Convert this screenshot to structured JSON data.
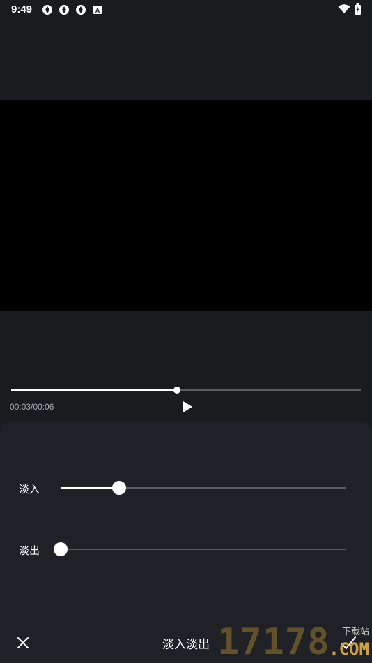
{
  "status_bar": {
    "time": "9:49",
    "notification_icons": [
      "aperture-icon",
      "aperture-icon",
      "aperture-icon",
      "a-badge-icon"
    ],
    "right_icons": [
      "wifi-icon",
      "battery-icon"
    ]
  },
  "player": {
    "progress_fraction": 0.475,
    "time_display": "00:03/00:06",
    "play_icon": "play-icon"
  },
  "panel": {
    "fade_in": {
      "label": "淡入",
      "value_fraction": 0.205
    },
    "fade_out": {
      "label": "淡出",
      "value_fraction": 0.0
    }
  },
  "bottom_bar": {
    "title": "淡入淡出",
    "close_icon": "close-icon",
    "confirm_icon": "check-icon"
  },
  "watermark": {
    "digits": "17178",
    "sub": "下载站",
    "domain": ".COM"
  },
  "colors": {
    "background": "#1a1b1f",
    "panel": "#202126",
    "track": "#5b5c61",
    "accent": "#ffffff"
  }
}
